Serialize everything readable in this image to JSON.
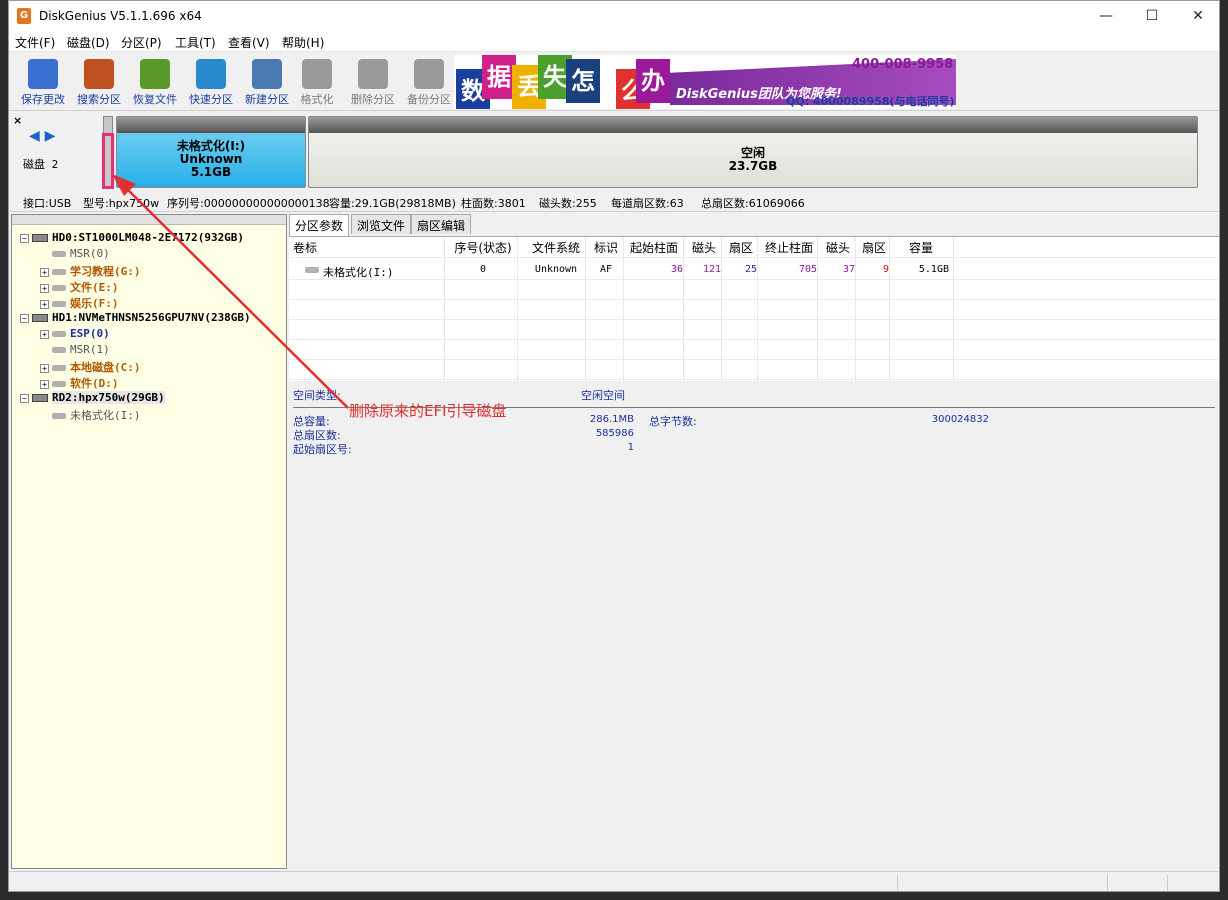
{
  "title": "DiskGenius V5.1.1.696 x64",
  "window_controls": {
    "minimize": "—",
    "maximize": "☐",
    "close": "✕"
  },
  "menu": [
    "文件(F)",
    "磁盘(D)",
    "分区(P)",
    "工具(T)",
    "查看(V)",
    "帮助(H)"
  ],
  "toolbar": [
    {
      "label": "保存更改",
      "icon": "save-icon",
      "color": "#3a6fd0",
      "enabled": true
    },
    {
      "label": "搜索分区",
      "icon": "search-icon",
      "color": "#c05020",
      "enabled": true
    },
    {
      "label": "恢复文件",
      "icon": "recover-icon",
      "color": "#5a9a2a",
      "enabled": true
    },
    {
      "label": "快速分区",
      "icon": "quick-partition-icon",
      "color": "#2a8ad0",
      "enabled": true
    },
    {
      "label": "新建分区",
      "icon": "new-partition-icon",
      "color": "#4a7ab0",
      "enabled": true
    },
    {
      "label": "格式化",
      "icon": "format-icon",
      "color": "#9a9a9a",
      "enabled": false
    },
    {
      "label": "删除分区",
      "icon": "delete-icon",
      "color": "#9a9a9a",
      "enabled": false
    },
    {
      "label": "备份分区",
      "icon": "backup-icon",
      "color": "#9a9a9a",
      "enabled": false
    }
  ],
  "banner": {
    "chars": [
      {
        "t": "数",
        "c": "#1a3fa0"
      },
      {
        "t": "据",
        "c": "#d0208a"
      },
      {
        "t": "丢",
        "c": "#f0b000"
      },
      {
        "t": "失",
        "c": "#4aa02a"
      },
      {
        "t": "怎",
        "c": "#1a4080"
      },
      {
        "t": "么",
        "c": "#e03030"
      },
      {
        "t": "办",
        "c": "#9a1a9a"
      }
    ],
    "brand": "DiskGenius团队为您服务!",
    "phone": "400-008-9958",
    "qq": "QQ: 4000089958(与电话同号)"
  },
  "disk_map": {
    "disk_label": "磁盘 2",
    "partition1": {
      "name": "未格式化(I:)",
      "fs": "Unknown",
      "size": "5.1GB"
    },
    "partition2": {
      "name": "空闲",
      "size": "23.7GB"
    }
  },
  "disk_info": {
    "interface": "接口:USB",
    "model": "型号:hpx750w",
    "serial": "序列号:000000000000000138",
    "capacity": "容量:29.1GB(29818MB)",
    "cylinders": "柱面数:3801",
    "heads": "磁头数:255",
    "sectors_per_track": "每道扇区数:63",
    "total_sectors": "总扇区数:61069066"
  },
  "tree": [
    {
      "label": "HD0:ST1000LM048-2E7172(932GB)",
      "level": 0,
      "kind": "disk",
      "style": "dark"
    },
    {
      "label": "MSR(0)",
      "level": 1,
      "kind": "part",
      "style": "gray"
    },
    {
      "label": "学习教程(G:)",
      "level": 1,
      "kind": "part",
      "style": "brown",
      "exp": true
    },
    {
      "label": "文件(E:)",
      "level": 1,
      "kind": "part",
      "style": "brown",
      "exp": true
    },
    {
      "label": "娱乐(F:)",
      "level": 1,
      "kind": "part",
      "style": "brown",
      "exp": true
    },
    {
      "label": "HD1:NVMeTHNSN5256GPU7NV(238GB)",
      "level": 0,
      "kind": "disk",
      "style": "dark"
    },
    {
      "label": "ESP(0)",
      "level": 1,
      "kind": "part",
      "style": "blue",
      "exp": true
    },
    {
      "label": "MSR(1)",
      "level": 1,
      "kind": "part",
      "style": "gray"
    },
    {
      "label": "本地磁盘(C:)",
      "level": 1,
      "kind": "part",
      "style": "brown",
      "exp": true
    },
    {
      "label": "软件(D:)",
      "level": 1,
      "kind": "part",
      "style": "brown",
      "exp": true
    },
    {
      "label": "RD2:hpx750w(29GB)",
      "level": 0,
      "kind": "disk",
      "style": "dark",
      "selected": true
    },
    {
      "label": "未格式化(I:)",
      "level": 1,
      "kind": "part",
      "style": "gray"
    }
  ],
  "tabs": [
    "分区参数",
    "浏览文件",
    "扇区编辑"
  ],
  "table": {
    "headers": [
      "卷标",
      "序号(状态)",
      "文件系统",
      "标识",
      "起始柱面",
      "磁头",
      "扇区",
      "终止柱面",
      "磁头",
      "扇区",
      "容量"
    ],
    "row": [
      "未格式化(I:)",
      "0",
      "Unknown",
      "AF",
      "36",
      "121",
      "25",
      "705",
      "37",
      "9",
      "5.1GB"
    ]
  },
  "details": {
    "space_type_label": "空间类型:",
    "space_type_value": "空闲空间",
    "total_capacity_label": "总容量:",
    "total_capacity_value": "286.1MB",
    "total_bytes_label": "总字节数:",
    "total_bytes_value": "300024832",
    "total_sectors_label": "总扇区数:",
    "total_sectors_value": "585986",
    "start_sector_label": "起始扇区号:",
    "start_sector_value": "1"
  },
  "annotation": {
    "text": "删除原来的EFI引导磁盘",
    "color": "#e03030"
  }
}
